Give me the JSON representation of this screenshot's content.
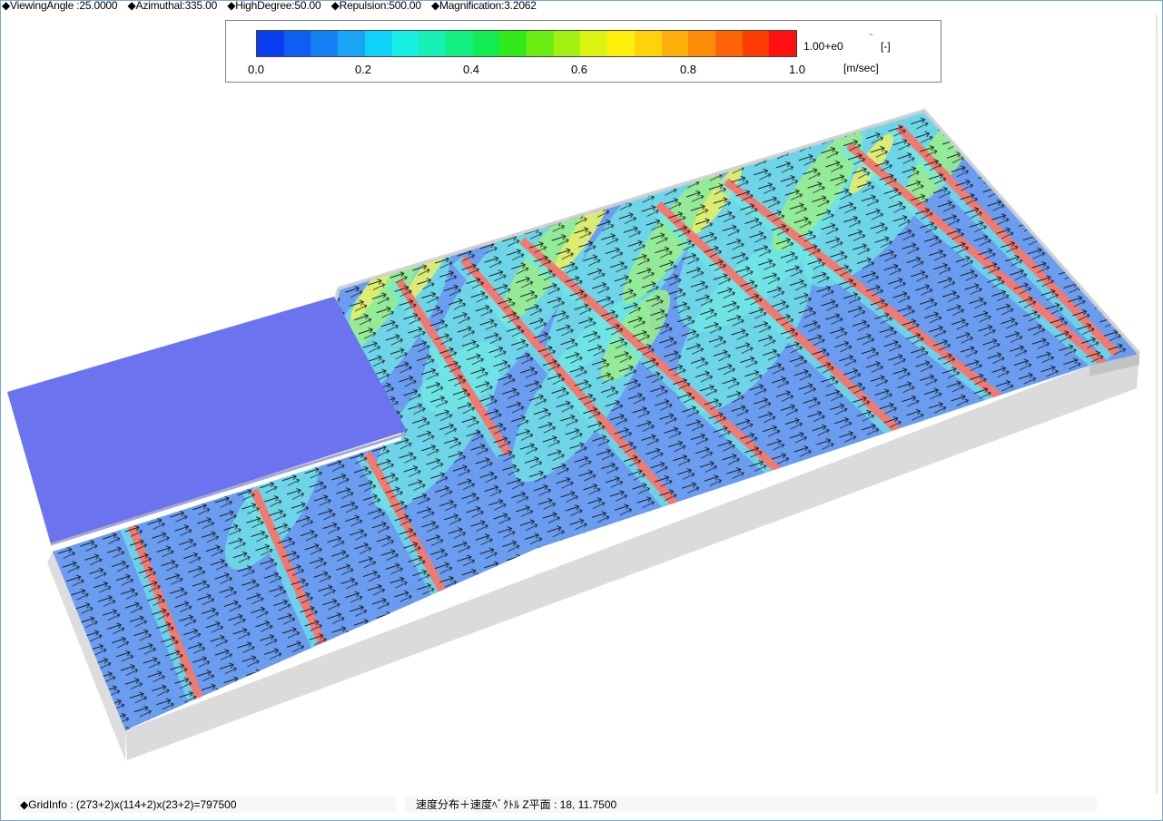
{
  "header": {
    "viewing_angle": "◆ViewingAngle :25.0000",
    "azimuthal": "◆Azimuthal:335.00",
    "high_degree": "◆HighDegree:50.00",
    "repulsion": "◆Repulsion:500.00",
    "magnification": "◆Magnification:3.2062"
  },
  "legend": {
    "ticks": [
      "0.0",
      "0.2",
      "0.4",
      "0.6",
      "0.8",
      "1.0"
    ],
    "scale": "1.00+e0",
    "unit_bracket": "[-]",
    "unit_speed": "[m/sec]",
    "tilde": "~",
    "colors": [
      "#0a3cf0",
      "#0f5ef2",
      "#1480f4",
      "#19a4f6",
      "#10d2f8",
      "#18f0e4",
      "#16f0b4",
      "#14ee80",
      "#12ec50",
      "#30ea1a",
      "#6cee14",
      "#a4f012",
      "#dcf212",
      "#fff00e",
      "#ffd20c",
      "#ffb00a",
      "#ff8c08",
      "#ff6406",
      "#ff3c04",
      "#ff1010"
    ]
  },
  "status": {
    "grid_info": "◆GridInfo : (273+2)x(114+2)x(23+2)=797500",
    "view_info": "速度分布＋速度ﾍﾞｸﾄﾙ Z平面 : 18,  11.7500"
  },
  "scene": {
    "colors": {
      "plane_blue": "#6b74ee",
      "base_field": "#6a9cf0",
      "cyan_flow": "#70e8e6",
      "green_flow": "#9aee8a",
      "yellow_flow": "#e6ee6a",
      "red_band": "#f07a72",
      "wall_grey": "#c8c8c8"
    }
  }
}
